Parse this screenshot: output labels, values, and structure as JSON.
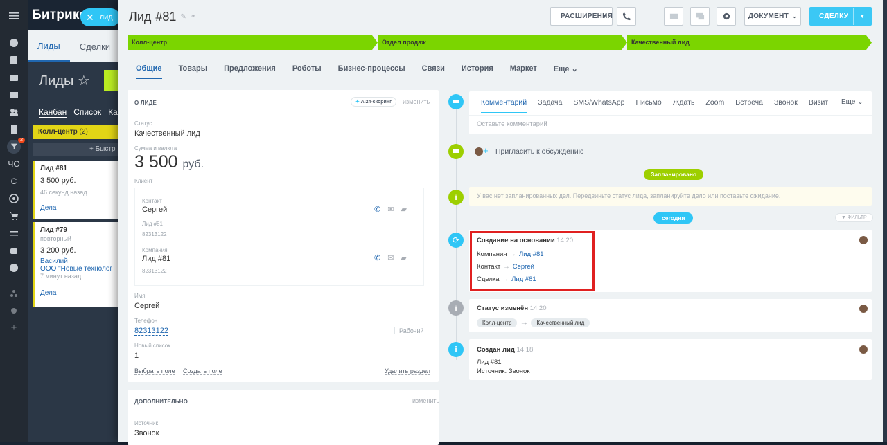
{
  "bg": {
    "title": "Битрикс",
    "chip": "лид",
    "tabs": [
      "Лиды",
      "Сделки"
    ],
    "heading": "Лиды",
    "views": [
      "Канбан",
      "Список",
      "Кал"
    ],
    "stage": "Колл-центр",
    "stage_count": "(2)",
    "add": "+ Быстр",
    "cards": [
      {
        "title": "Лид #81",
        "amount": "3 500 руб.",
        "time": "46 секунд назад",
        "action": "Дела"
      },
      {
        "title": "Лид #79",
        "sub": "повторный",
        "amount": "3 200 руб.",
        "name": "Василий",
        "company": "ООО \"Новые технологи",
        "time": "7 минут назад",
        "action": "Дела"
      }
    ],
    "sidebar_badge": "2",
    "sidebar_letters": [
      "ЧО",
      "С"
    ]
  },
  "header": {
    "title": "Лид",
    "number": "#81",
    "ext": "РАСШИРЕНИЯ",
    "doc": "ДОКУМЕНТ",
    "deal": "СДЕЛКУ"
  },
  "stages": [
    "Колл-центр",
    "Отдел продаж",
    "Качественный лид"
  ],
  "tabs": [
    "Общие",
    "Товары",
    "Предложения",
    "Роботы",
    "Бизнес-процессы",
    "Связи",
    "История",
    "Маркет",
    "Еще"
  ],
  "about": {
    "title": "О ЛИДЕ",
    "scoring": "AI24-скоринг",
    "edit": "изменить",
    "status_label": "Статус",
    "status": "Качественный лид",
    "sum_label": "Сумма и валюта",
    "sum": "3 500",
    "currency": "руб.",
    "client_label": "Клиент",
    "contact_label": "Контакт",
    "contact": "Сергей",
    "contact_sub": "Лид #81",
    "contact_phone": "82313122",
    "company_label": "Компания",
    "company": "Лид #81",
    "company_phone": "82313122",
    "name_label": "Имя",
    "name": "Сергей",
    "phone_label": "Телефон",
    "phone": "82313122",
    "phone_type": "Рабочий",
    "list_label": "Новый список",
    "list": "1",
    "choose": "Выбрать поле",
    "create": "Создать поле",
    "remove": "Удалить раздел"
  },
  "extra": {
    "title": "ДОПОЛНИТЕЛЬНО",
    "edit": "изменить",
    "source_label": "Источник",
    "source": "Звонок"
  },
  "timeline": {
    "tabs": [
      "Комментарий",
      "Задача",
      "SMS/WhatsApp",
      "Письмо",
      "Ждать",
      "Zoom",
      "Встреча",
      "Звонок",
      "Визит"
    ],
    "more": "Еще",
    "placeholder": "Оставьте комментарий",
    "invite": "Пригласить к обсуждению",
    "planned": "Запланировано",
    "notice": "У вас нет запланированных дел. Передвиньте статус лида, запланируйте дело или поставьте ожидание.",
    "today": "сегодня",
    "filter": "ФИЛЬТР",
    "e1": {
      "title": "Создание на основании",
      "time": "14:20",
      "rows": [
        [
          "Компания",
          "Лид #81"
        ],
        [
          "Контакт",
          "Сергей"
        ],
        [
          "Сделка",
          "Лид #81"
        ]
      ]
    },
    "e2": {
      "title": "Статус изменён",
      "time": "14:20",
      "from": "Колл-центр",
      "to": "Качественный лид"
    },
    "e3": {
      "title": "Создан лид",
      "time": "14:18",
      "line1": "Лид #81",
      "line2": "Источник: Звонок"
    }
  },
  "colors": {
    "accent": "#2fc6f6",
    "stage": "#7bd500",
    "link": "#2067b0",
    "highlight": "#e02020"
  }
}
